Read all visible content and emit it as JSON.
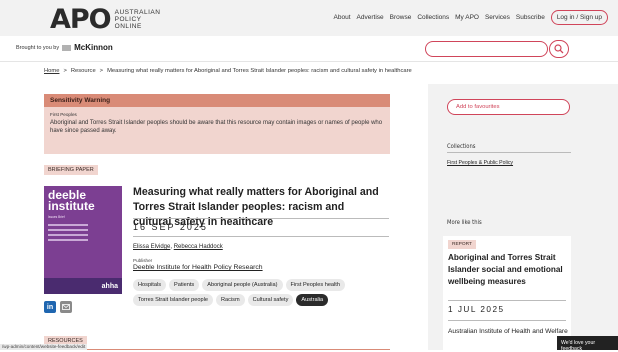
{
  "header": {
    "logo_main": "APO",
    "logo_sub_1": "AUSTRALIAN",
    "logo_sub_2": "POLICY",
    "logo_sub_3": "ONLINE",
    "nav": [
      "About",
      "Advertise",
      "Browse",
      "Collections",
      "My APO",
      "Services",
      "Subscribe"
    ],
    "login_label": "Log in / Sign up"
  },
  "sponsor": {
    "brought_by": "Brought to you by",
    "name": "McKinnon"
  },
  "search": {
    "placeholder": ""
  },
  "breadcrumb": {
    "home": "Home",
    "sep": ">",
    "resource": "Resource",
    "current": "Measuring what really matters for Aboriginal and Torres Strait Islander peoples: racism and cultural safety in healthcare"
  },
  "warning": {
    "heading": "Sensitivity Warning",
    "sub": "First Peoples",
    "body": "Aboriginal and Torres Strait Islander peoples should be aware that this resource may contain images or names of people who have since passed away."
  },
  "resource": {
    "type_label": "BRIEFING PAPER",
    "title": "Measuring what really matters for Aboriginal and Torres Strait Islander peoples: racism and cultural safety in healthcare",
    "date": "16 SEP 2025",
    "author_1": "Elissa Elvidge",
    "author_2": "Rebecca Haddock",
    "publisher_label": "Publisher",
    "publisher": "Deeble Institute for Health Policy Research",
    "tags": [
      "Hospitals",
      "Patients",
      "Aboriginal people (Australia)",
      "First Peoples health",
      "Torres Strait Islander people",
      "Racism",
      "Cultural safety",
      "Australia"
    ],
    "cover_title_1": "deeble",
    "cover_title_2": "institute",
    "cover_sub": "Issues Brief",
    "cover_brand": "ahha"
  },
  "resources_label": "RESOURCES",
  "status_url": "/wp-admin/content/website-feedback/edit",
  "sidebar": {
    "favourites_label": "Add to favourites",
    "collections_heading": "Collections",
    "collection_link": "First Peoples & Public Policy",
    "more_heading": "More like this",
    "card_tag": "REPORT",
    "card_title": "Aboriginal and Torres Strait Islander social and emotional wellbeing measures",
    "card_date": "1 JUL 2025",
    "card_publisher": "Australian Institute of Health and Welfare"
  },
  "feedback_label": "We'd love your feedback",
  "colors": {
    "accent": "#d0455a",
    "warning_head": "#d98b77",
    "warning_bg": "#f1d5cf",
    "sidebar_bg": "#f2f2f2"
  }
}
